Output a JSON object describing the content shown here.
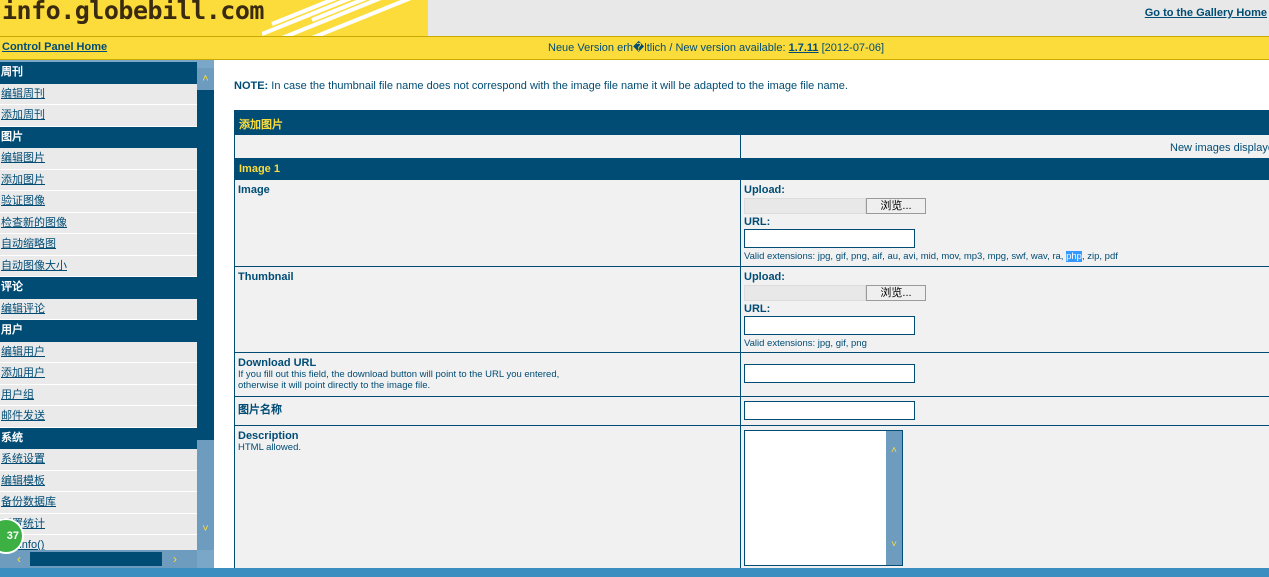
{
  "header": {
    "logo_text": "info.globebill.com",
    "gallery_link": "Go to the Gallery Home"
  },
  "bar": {
    "cp_home": "Control Panel Home",
    "version_prefix": "Neue Version erh�ltlich / New version available:",
    "version_number": "1.7.11",
    "version_date": "[2012-07-06]"
  },
  "sidebar": {
    "sections": [
      {
        "title": "周刊",
        "items": [
          "编辑周刊",
          "添加周刊"
        ]
      },
      {
        "title": "图片",
        "items": [
          "编辑图片",
          "添加图片",
          "验证图像",
          "检查新的图像",
          "自动缩略图",
          "自动图像大小"
        ]
      },
      {
        "title": "评论",
        "items": [
          "编辑评论"
        ]
      },
      {
        "title": "用户",
        "items": [
          "编辑用户",
          "添加用户",
          "用户组",
          "邮件发送"
        ]
      },
      {
        "title": "系统",
        "items": [
          "系统设置",
          "编辑模板",
          "备份数据库",
          "配置统计",
          "phpinfo()"
        ]
      }
    ],
    "badge": "37"
  },
  "main": {
    "note_bold": "NOTE:",
    "note_text": "In case the thumbnail file name does not correspond with the image file name it will be adapted to the image file name.",
    "form_title": "添加图片",
    "new_images_text": "New images displaye",
    "image_header": "Image 1",
    "image": {
      "label": "Image",
      "upload": "Upload:",
      "browse": "浏览...",
      "url": "URL:",
      "ext_before": "Valid extensions: jpg, gif, png, aif, au, avi, mid, mov, mp3, mpg, swf, wav, ra, ",
      "ext_hl": "php",
      "ext_after": ", zip, pdf"
    },
    "thumb": {
      "label": "Thumbnail",
      "upload": "Upload:",
      "browse": "浏览...",
      "url": "URL:",
      "ext": "Valid extensions: jpg, gif, png"
    },
    "download": {
      "label": "Download URL",
      "help1": "If you fill out this field, the download button will point to the URL you entered,",
      "help2": "otherwise it will point directly to the image file."
    },
    "name": {
      "label": "图片名称"
    },
    "desc": {
      "label": "Description",
      "help": "HTML allowed."
    }
  },
  "colors": {
    "brand_yellow": "#fcdc3b",
    "brand_blue": "#004c75",
    "arrow_red": "#e8141a"
  }
}
